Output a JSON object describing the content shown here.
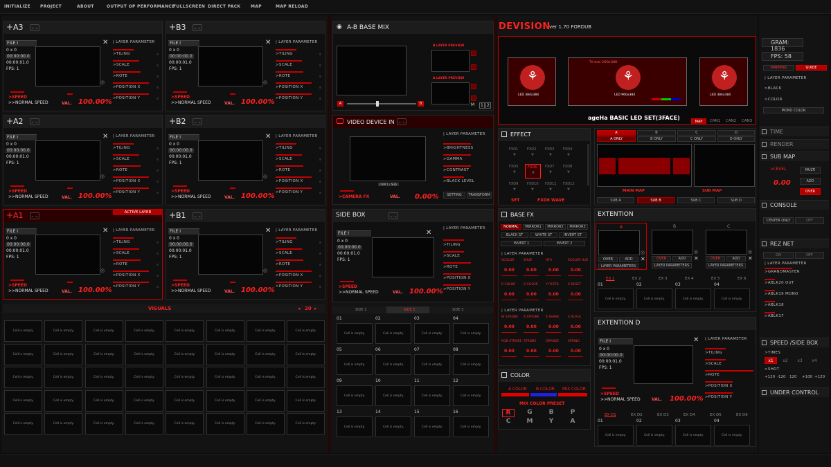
{
  "menu": [
    "INITIALIZE",
    "PROJECT",
    "ABOUT",
    "OUTPUT OP",
    "PERFORMANCE",
    "FULLSCREEN",
    "DIRECT PACK",
    "MAP",
    "MAP RELOAD"
  ],
  "layers": [
    {
      "name": "A3",
      "active": false
    },
    {
      "name": "B3",
      "active": false
    },
    {
      "name": "A2",
      "active": false
    },
    {
      "name": "B2",
      "active": false
    },
    {
      "name": "A1",
      "active": true
    },
    {
      "name": "B1",
      "active": false
    }
  ],
  "layer_common": {
    "file": "FILE I",
    "size": "0 x 0",
    "time1": "00:00:00.0",
    "time2": "00:00:01.0",
    "fps": "FPS:  1",
    "speed": ">SPEED",
    "normal": ">>NORMAL SPEED",
    "val": "VAL.",
    "val_num": "100.00%",
    "layer_param": "| LAYER PARAMETER",
    "tiling": ">TILING",
    "scale": ">SCALE",
    "rote": ">ROTE",
    "pos_x": ">POSITION X",
    "pos_y": ">POSITION Y",
    "active_label": "ACTIVE LAYER"
  },
  "visuals": {
    "label": "VISUALS",
    "count": "20",
    "empty": "Cell is empty."
  },
  "abmix": {
    "title": "A-B BASE MIX",
    "b_preview": "B LAYER PREVIEW",
    "a_preview": "A LAYER PREVIEW",
    "a": "A",
    "b": "B",
    "s1": "S1",
    "s2": "S2",
    "m": "M",
    "n1": "1",
    "n2": "2"
  },
  "video": {
    "title": "VIDEO DEVICE IN",
    "layer_param": "| LAYER PARAMETER",
    "brightness": ">BRIGHTNESS",
    "gamma": ">GAMMA",
    "contrast": ">CONTRAST",
    "black": ">BLACK LEVEL",
    "setting": "SETTING",
    "transform": "TRANSFORM",
    "camera": ">CAMERA FX",
    "val": "VAL.",
    "val_num": "0.00%",
    "caption": "CAM 1 / SIZE"
  },
  "sidebox": {
    "title": "SIDE BOX",
    "tabs": [
      "SIDE 1",
      "SIDE 2",
      "SIDE 3"
    ],
    "cells": [
      "01",
      "02",
      "03",
      "04",
      "05",
      "06",
      "07",
      "08",
      "09",
      "10",
      "11",
      "12",
      "13",
      "14",
      "15",
      "16"
    ]
  },
  "devision": {
    "title": "DEVISION",
    "version": "ver 1.70 FORDUB",
    "caption": "ageHa BASIC LED SET(3FACE)",
    "led": "LED 384x384",
    "map_tabs": [
      "MAP",
      "CAN1",
      "CAN2",
      "CAN3"
    ],
    "mid_label": "TV main 1920x1080",
    "mid_label2": "LED 960x384"
  },
  "stats": {
    "gram": "GRAM: 1836",
    "fps": "FPS: 58",
    "mapping": "MAPPING",
    "guide": "GUIDE",
    "layer_param": "| LAYER PARAMETER",
    "black": ">BLACK",
    "color": ">COLOR",
    "mono": "MONO COLOR"
  },
  "sections": {
    "time": "TIME",
    "render": "RENDER",
    "submap": "SUB MAP",
    "level": ">LEVEL",
    "level_val": "0.00",
    "multi": "MULTI",
    "add": "ADD",
    "over": "OVER",
    "console": "CONSOLE",
    "center_only": "CENTER ONLY",
    "off": "OFF",
    "reznet": "REZ NET",
    "on": "ON",
    "rez_items": [
      ">GRANDMASTER",
      ">ABLK20 OUT",
      ">ABLK19 MONO",
      ">ABLK18",
      ">ABLK17"
    ],
    "speed_side": "SPEED /SIDE BOX",
    "times": ">TIMES",
    "shot": ">SHOT",
    "mult": [
      "x1",
      "x2",
      "x3",
      "x4"
    ],
    "shots": [
      "+120",
      "-120",
      "120",
      "+100",
      "+120"
    ],
    "under": "UNDER CONTROL"
  },
  "effect": {
    "title": "EFFECT",
    "items": [
      "FXD1",
      "FXD2",
      "FXD3",
      "FXD4",
      "FXD5",
      "FXD6",
      "FXD7",
      "FXD8",
      "FXD9",
      "FXD10",
      "FXD11",
      "FXD12"
    ],
    "set": "SET",
    "wave": "FXD6 WAVE"
  },
  "baseabcd": {
    "letters": [
      "A",
      "B",
      "C",
      "D"
    ],
    "a_only": "A ONLY",
    "b_only": "B ONLY",
    "c_only": "C ONLY",
    "d_only": "D ONLY",
    "main_map": "MAIN MAP",
    "sub_map": "SUB MAP",
    "subtabs": [
      "SUB A",
      "SUB B",
      "SUB C",
      "SUB D"
    ]
  },
  "basefx": {
    "title": "BASE FX",
    "row1": [
      "NORMAL",
      "MIRROR1",
      "MIRROR2",
      "MIRROR3"
    ],
    "row2": [
      "BLACK ST",
      "WHITE ST",
      "INVERT ST"
    ],
    "row3": [
      "INVERT 1",
      "INVERT 2"
    ],
    "lp": "| LAYER PARAMETER",
    "g1": [
      "SCOLOR",
      "SHUE",
      "HFX",
      "SCOLOR HUE"
    ],
    "g2": [
      "R COLOR",
      "G COLOR",
      "Y FILTER",
      "X RESET"
    ],
    "g3": [
      "W STROBE",
      "X STROBE",
      "X SHAKE",
      "X SCALE"
    ],
    "g4": [
      "RGB STROBE",
      "STROBE",
      "ORANGE",
      "SPRING"
    ],
    "zero": "0.00"
  },
  "color": {
    "title": "COLOR",
    "a": "A COLOR",
    "b": "B COLOR",
    "mix": "MIX COLOR",
    "preset": "MIX COLOR PRESET",
    "keys1": [
      "R",
      "G",
      "B",
      "P"
    ],
    "keys2": [
      "C",
      "M",
      "Y",
      "A"
    ]
  },
  "extention": {
    "title": "EXTENTION",
    "cols": [
      "A",
      "B",
      "C"
    ],
    "over": "OVER",
    "add": "ADD",
    "lp": "LAYER PARAMETERS",
    "ex": [
      "EX 1",
      "EX 2",
      "EX 3",
      "EX 4",
      "EX 5",
      "EX 6"
    ],
    "nums": [
      "01",
      "02",
      "03",
      "04"
    ]
  },
  "extention_d": {
    "title": "EXTENTION D",
    "ex": [
      "EX D1",
      "EX D2",
      "EX D3",
      "EX D4",
      "EX D5",
      "EX D6"
    ],
    "nums": [
      "01",
      "02",
      "03",
      "04"
    ]
  }
}
